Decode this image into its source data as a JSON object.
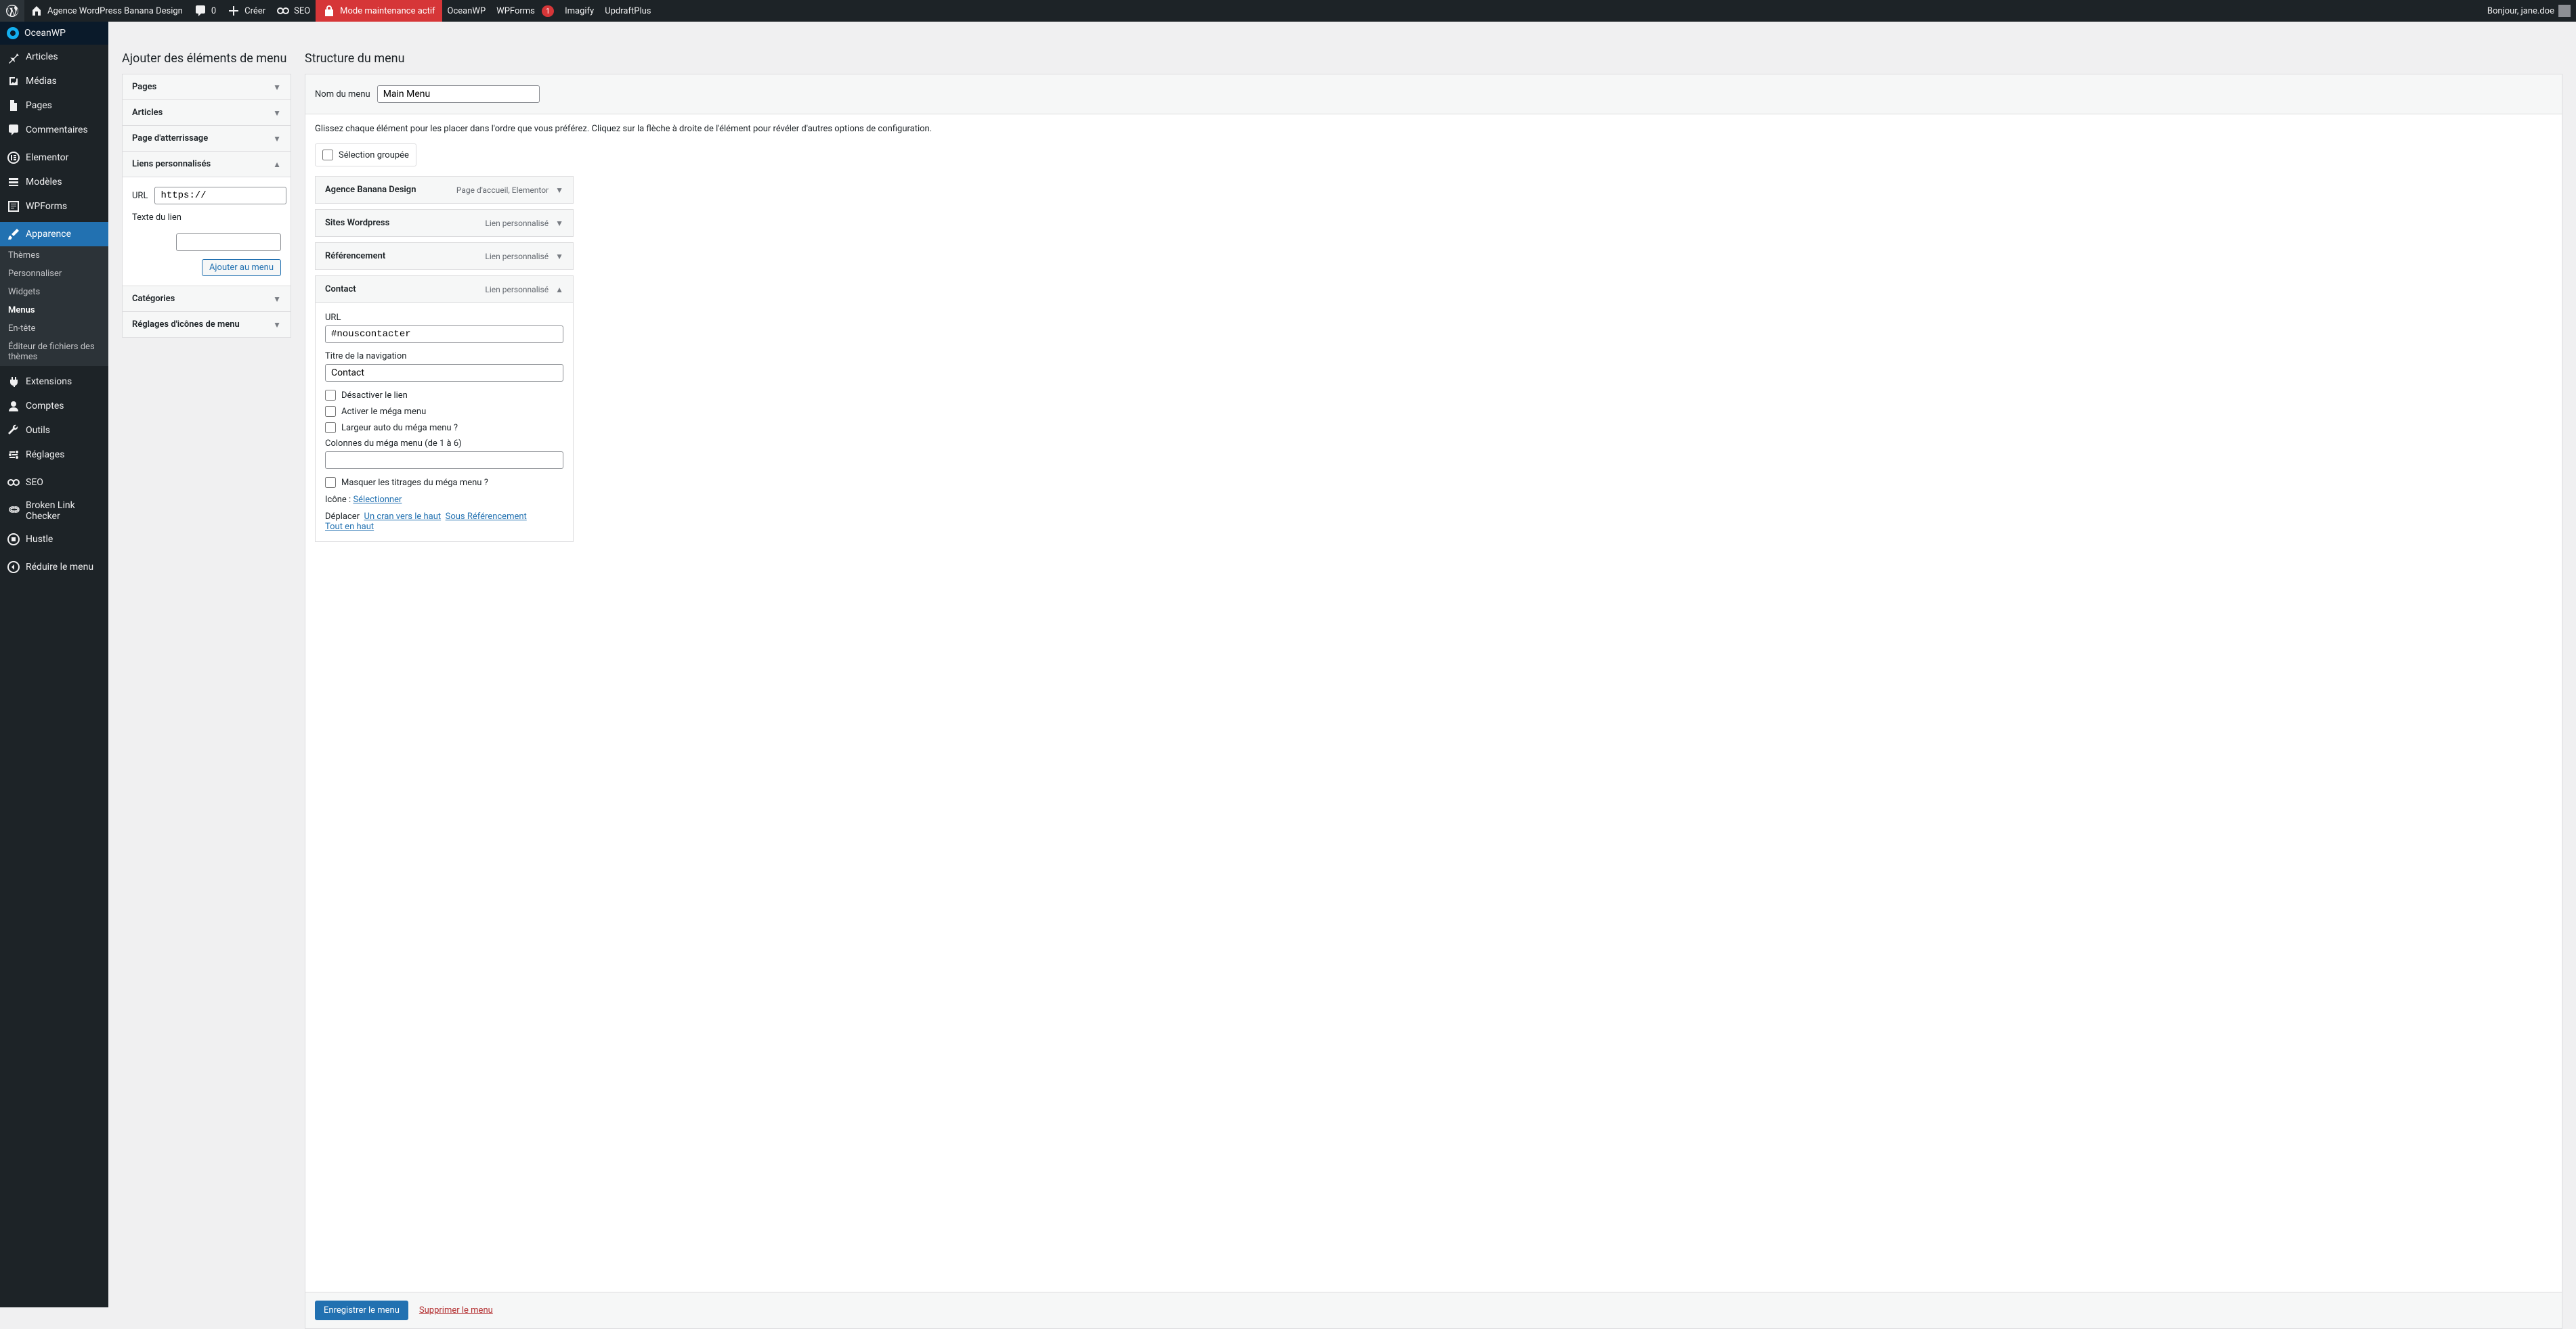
{
  "adminbar": {
    "site_name": "Agence WordPress Banana Design",
    "comments_count": "0",
    "create": "Créer",
    "seo": "SEO",
    "maintenance": "Mode maintenance actif",
    "oceanwp": "OceanWP",
    "wpforms": "WPForms",
    "wpforms_badge": "1",
    "imagify": "Imagify",
    "updraft": "UpdraftPlus",
    "greeting": "Bonjour, jane.doe"
  },
  "sidebar": {
    "items": [
      "OceanWP",
      "Articles",
      "Médias",
      "Pages",
      "Commentaires",
      "Elementor",
      "Modèles",
      "WPForms",
      "Apparence"
    ],
    "appearance_sub": [
      "Thèmes",
      "Personnaliser",
      "Widgets",
      "Menus",
      "En-tête",
      "Éditeur de fichiers des thèmes"
    ],
    "items2": [
      "Extensions",
      "Comptes",
      "Outils",
      "Réglages",
      "SEO",
      "Broken Link Checker",
      "Hustle",
      "Réduire le menu"
    ]
  },
  "left": {
    "heading": "Ajouter des éléments de menu",
    "panels": {
      "pages": "Pages",
      "articles": "Articles",
      "landing": "Page d'atterrissage",
      "custom": "Liens personnalisés",
      "categories": "Catégories",
      "icons": "Réglages d'icônes de menu"
    },
    "custom_form": {
      "url_label": "URL",
      "url_value": "https://",
      "text_label": "Texte du lien",
      "add_btn": "Ajouter au menu"
    }
  },
  "right": {
    "heading": "Structure du menu",
    "name_label": "Nom du menu",
    "name_value": "Main Menu",
    "hint": "Glissez chaque élément pour les placer dans l'ordre que vous préférez. Cliquez sur la flèche à droite de l'élément pour révéler d'autres options de configuration.",
    "bulk": "Sélection groupée",
    "items": [
      {
        "title": "Agence Banana Design",
        "type": "Page d'accueil, Elementor"
      },
      {
        "title": "Sites Wordpress",
        "type": "Lien personnalisé"
      },
      {
        "title": "Référencement",
        "type": "Lien personnalisé"
      },
      {
        "title": "Contact",
        "type": "Lien personnalisé"
      }
    ],
    "contact_panel": {
      "url_label": "URL",
      "url_value": "#nouscontacter",
      "nav_label": "Titre de la navigation",
      "nav_value": "Contact",
      "disable": "Désactiver le lien",
      "mega": "Activer le méga menu",
      "mega_auto": "Largeur auto du méga menu ?",
      "cols_label": "Colonnes du méga menu (de 1 à 6)",
      "hide_titles": "Masquer les titrages du méga menu ?",
      "icon_label": "Icône : ",
      "icon_select": "Sélectionner",
      "move_label": "Déplacer",
      "move_up": "Un cran vers le haut",
      "move_under": "Sous Référencement",
      "move_top": "Tout en haut"
    },
    "save": "Enregistrer le menu",
    "delete": "Supprimer le menu"
  }
}
